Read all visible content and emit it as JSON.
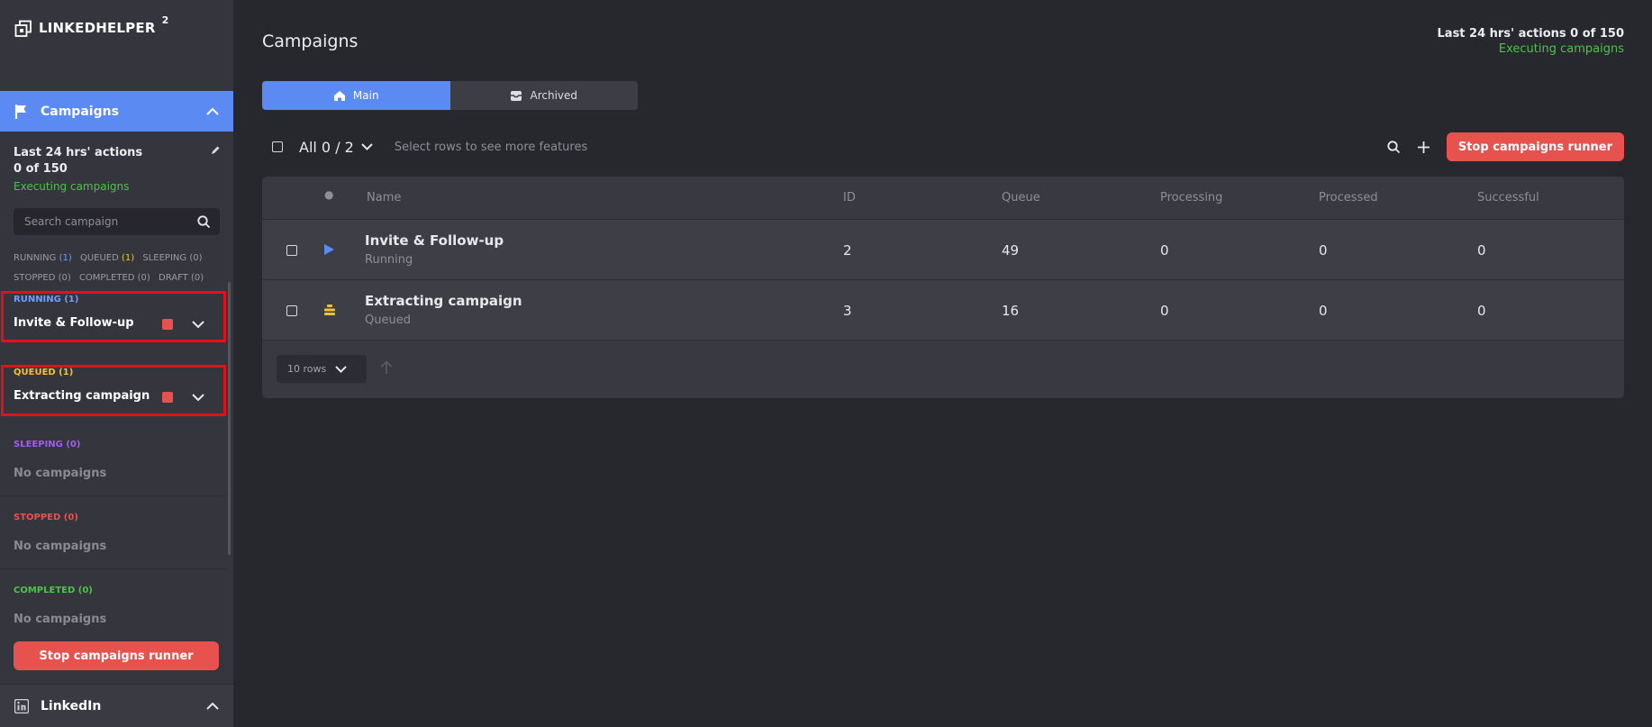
{
  "app": {
    "logo_text": "LINKEDHELPER",
    "logo_sup": "2"
  },
  "sidebar": {
    "campaigns_header": "Campaigns",
    "stats_title_line1": "Last 24 hrs' actions",
    "stats_title_line2": "0 of 150",
    "stats_status": "Executing campaigns",
    "search_placeholder": "Search campaign",
    "filters": {
      "running": "RUNNING",
      "running_count": "(1)",
      "queued": "QUEUED",
      "queued_count": "(1)",
      "sleeping": "SLEEPING (0)",
      "stopped": "STOPPED (0)",
      "completed": "COMPLETED (0)",
      "draft": "DRAFT (0)"
    },
    "groups": {
      "running": {
        "title": "RUNNING (1)",
        "campaign": "Invite & Follow-up"
      },
      "queued": {
        "title": "QUEUED (1)",
        "campaign": "Extracting campaign"
      },
      "sleeping": {
        "title": "SLEEPING (0)",
        "empty": "No campaigns"
      },
      "stopped": {
        "title": "STOPPED (0)",
        "empty": "No campaigns"
      },
      "completed": {
        "title": "COMPLETED (0)",
        "empty": "No campaigns"
      }
    },
    "stop_button": "Stop campaigns runner",
    "linkedin_header": "LinkedIn"
  },
  "main": {
    "title": "Campaigns",
    "top_stats_line1": "Last 24 hrs' actions 0 of 150",
    "top_stats_line2": "Executing campaigns",
    "tabs": {
      "main": "Main",
      "archived": "Archived"
    },
    "toolbar": {
      "all_selection": "All 0 / 2",
      "hint": "Select rows to see more features",
      "stop_button": "Stop campaigns runner"
    },
    "table": {
      "headers": {
        "status": "●",
        "name": "Name",
        "id": "ID",
        "queue": "Queue",
        "processing": "Processing",
        "processed": "Processed",
        "successful": "Successful"
      },
      "rows": [
        {
          "name": "Invite & Follow-up",
          "status": "Running",
          "id": "2",
          "queue": "49",
          "processing": "0",
          "processed": "0",
          "successful": "0"
        },
        {
          "name": "Extracting campaign",
          "status": "Queued",
          "id": "3",
          "queue": "16",
          "processing": "0",
          "processed": "0",
          "successful": "0"
        }
      ],
      "rows_per_page": "10 rows"
    }
  },
  "colors": {
    "accent": "#5b8af3",
    "danger": "#e8524e",
    "success": "#4fc24a",
    "queued": "#f2c230",
    "sleeping": "#a25cf0",
    "highlight_border": "#e3101a"
  }
}
